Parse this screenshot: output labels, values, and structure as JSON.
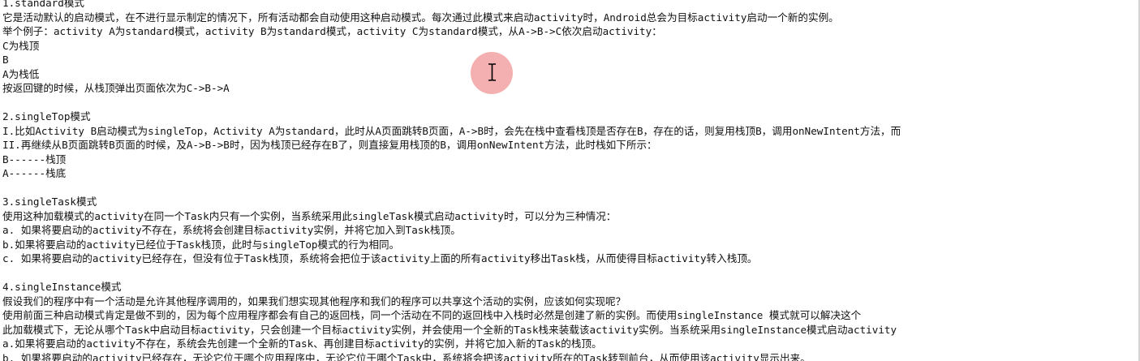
{
  "document": {
    "lines": [
      "1.standard模式",
      "它是活动默认的启动模式，在不进行显示制定的情况下，所有活动都会自动使用这种启动模式。每次通过此模式来启动activity时，Android总会为目标activity启动一个新的实例。",
      "举个例子：activity A为standard模式，activity B为standard模式，activity C为standard模式，从A->B->C依次启动activity：",
      "C为栈顶",
      "B",
      "A为栈低",
      "按返回键的时候，从栈顶弹出页面依次为C->B->A",
      "",
      "2.singleTop模式",
      "I.比如Activity B启动模式为singleTop，Activity A为standard，此时从A页面跳转B页面，A->B时，会先在栈中查看栈顶是否存在B，存在的话，则复用栈顶B，调用onNewIntent方法，而",
      "II.再继续从B页面跳转B页面的时候，及A->B->B时，因为栈顶已经存在B了，则直接复用栈顶的B，调用onNewIntent方法，此时栈如下所示：",
      "B------栈顶",
      "A------栈底",
      "",
      "3.singleTask模式",
      "使用这种加载模式的activity在同一个Task内只有一个实例，当系统采用此singleTask模式启动activity时，可以分为三种情况：",
      "a. 如果将要启动的activity不存在，系统将会创建目标activity实例，并将它加入到Task栈顶。",
      "b.如果将要启动的activity已经位于Task栈顶，此时与singleTop模式的行为相同。",
      "c. 如果将要启动的activity已经存在，但没有位于Task栈顶，系统将会把位于该activity上面的所有activity移出Task栈，从而使得目标activity转入栈顶。",
      "",
      "4.singleInstance模式",
      "假设我们的程序中有一个活动是允许其他程序调用的，如果我们想实现其他程序和我们的程序可以共享这个活动的实例，应该如何实现呢？",
      "使用前面三种启动模式肯定是做不到的，因为每个应用程序都会有自己的返回栈，同一个活动在不同的返回栈中入栈时必然是创建了新的实例。而使用singleInstance 模式就可以解决这个",
      "此加载模式下，无论从哪个Task中启动目标activity，只会创建一个目标activity实例，并会使用一个全新的Task栈来装载该activity实例。当系统采用singleInstance模式启动activity",
      "a.如果将要启动的activity不存在，系统会先创建一个全新的Task、再创建目标activity的实例，并将它加入新的Task的栈顶。",
      "b. 如果将要启动的activity已经存在，无论它位于哪个应用程序中，无论它位于哪个Task中，系统将会把该activity所在的Task转到前台，从而使用该activity显示出来。"
    ]
  },
  "colors": {
    "text": "#111111",
    "background": "#ffffff",
    "cursor_highlight": "#f09696"
  },
  "icons": {
    "cursor": "i-beam-cursor-icon"
  }
}
